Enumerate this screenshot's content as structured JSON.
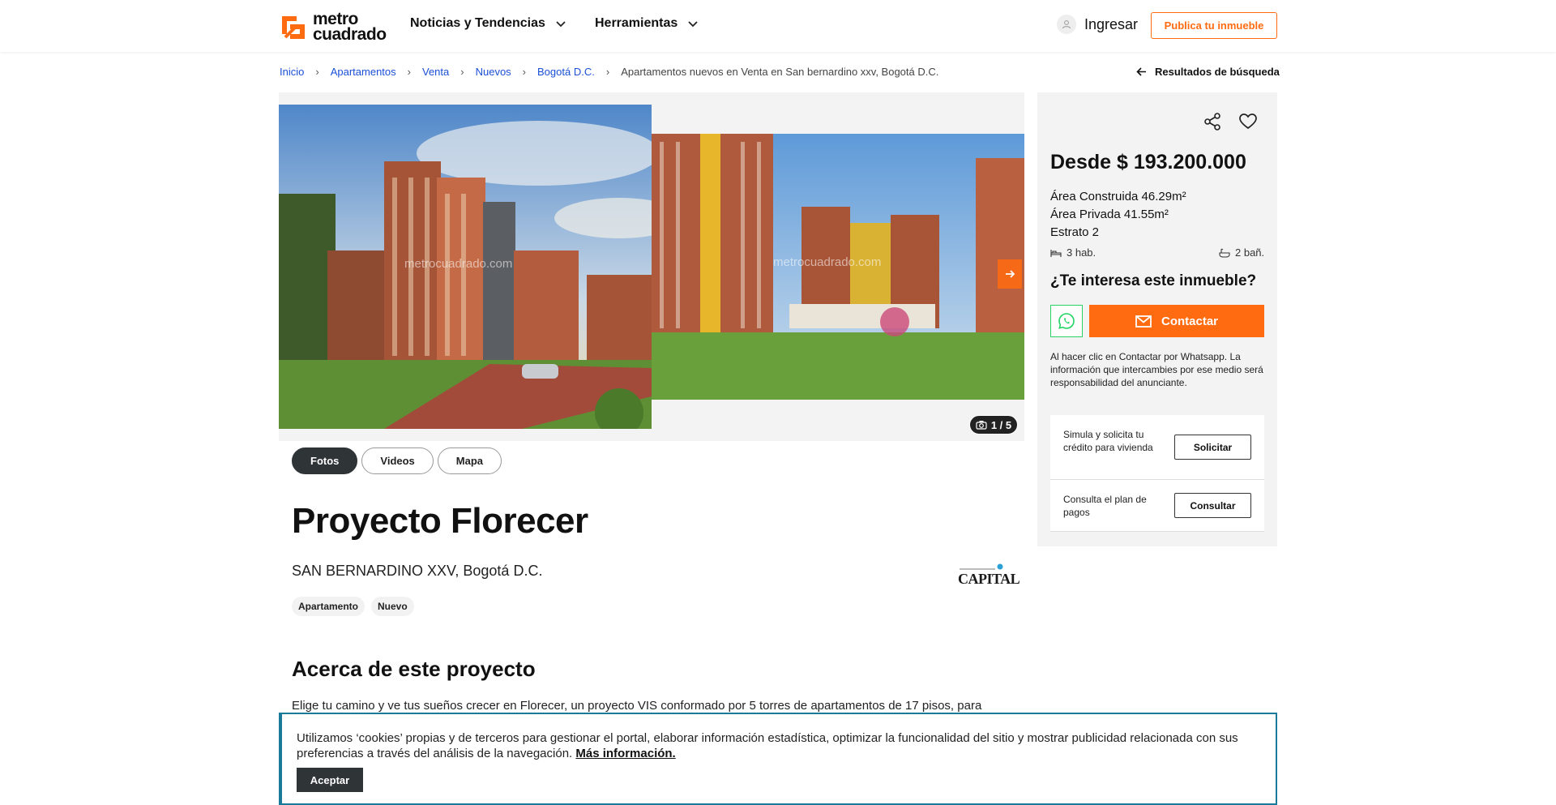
{
  "header": {
    "logo_line1": "metro",
    "logo_line2": "cuadrado",
    "nav": [
      {
        "label": "Noticias y Tendencias"
      },
      {
        "label": "Herramientas"
      }
    ],
    "login_label": "Ingresar",
    "publish_label": "Publica tu inmueble",
    "accent": "#ff6b11"
  },
  "breadcrumb": {
    "items": [
      "Inicio",
      "Apartamentos",
      "Venta",
      "Nuevos",
      "Bogotá D.C."
    ],
    "separator": "›",
    "current": "Apartamentos nuevos en Venta en San bernardino xxv, Bogotá D.C.",
    "back_label": "Resultados de búsqueda"
  },
  "gallery": {
    "watermark": "metrocuadrado.com",
    "counter": "1 / 5"
  },
  "media_tabs": [
    "Fotos",
    "Videos",
    "Mapa"
  ],
  "property": {
    "title": "Proyecto Florecer",
    "location": "SAN BERNARDINO XXV, Bogotá D.C.",
    "tags": [
      "Apartamento",
      "Nuevo"
    ],
    "builder_logo_text": "CAPITAL"
  },
  "about": {
    "title": "Acerca de este proyecto",
    "text": "Elige tu camino y ve tus sueños crecer en Florecer, un proyecto VIS conformado por 5 torres de apartamentos de 17 pisos, para"
  },
  "sidebar": {
    "price": "Desde $ 193.200.000",
    "area_built": "Área Construida 46.29m²",
    "area_private": "Área Privada 41.55m²",
    "estrato": "Estrato 2",
    "beds": "3 hab.",
    "baths": "2 bañ.",
    "interest_title": "¿Te interesa este inmueble?",
    "contact_label": "Contactar",
    "disclaimer": "Al hacer clic en Contactar por Whatsapp. La información que intercambies por ese medio será responsabilidad del anunciante.",
    "credit_text": "Simula y solicita tu crédito para vivienda",
    "credit_button": "Solicitar",
    "plan_text": "Consulta el plan de pagos",
    "plan_button": "Consultar"
  },
  "cookie": {
    "text": "Utilizamos ‘cookies’ propias y de terceros para gestionar el portal, elaborar información estadística, optimizar la funcionalidad del sitio y mostrar publicidad relacionada con sus preferencias a través del análisis de la navegación.",
    "link": "Más información.",
    "accept": "Aceptar"
  }
}
